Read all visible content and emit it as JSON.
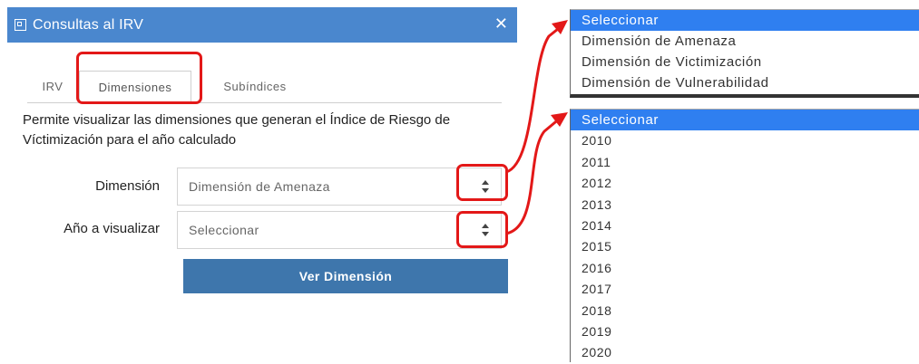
{
  "dialog": {
    "title": "Consultas al IRV",
    "close": "✕",
    "tabs": {
      "irv": "IRV",
      "dimensiones": "Dimensiones",
      "subindices": "Subíndices"
    },
    "description": "Permite visualizar las dimensiones que generan el Índice de Riesgo de Víctimización para el año calculado",
    "fields": {
      "dimension_label": "Dimensión",
      "dimension_value": "Dimensión de Amenaza",
      "ano_label": "Año a visualizar",
      "ano_value": "Seleccionar"
    },
    "button_label": "Ver Dimensión"
  },
  "dimension_options": [
    "Seleccionar",
    "Dimensión de Amenaza",
    "Dimensión de Victimización",
    "Dimensión de Vulnerabilidad"
  ],
  "year_options": [
    "Seleccionar",
    "2010",
    "2011",
    "2012",
    "2013",
    "2014",
    "2015",
    "2016",
    "2017",
    "2018",
    "2019",
    "2020"
  ],
  "colors": {
    "titlebar": "#4A87CE",
    "button": "#3E76AC",
    "highlight": "#E31818",
    "selected_option": "#2F7FF0"
  }
}
